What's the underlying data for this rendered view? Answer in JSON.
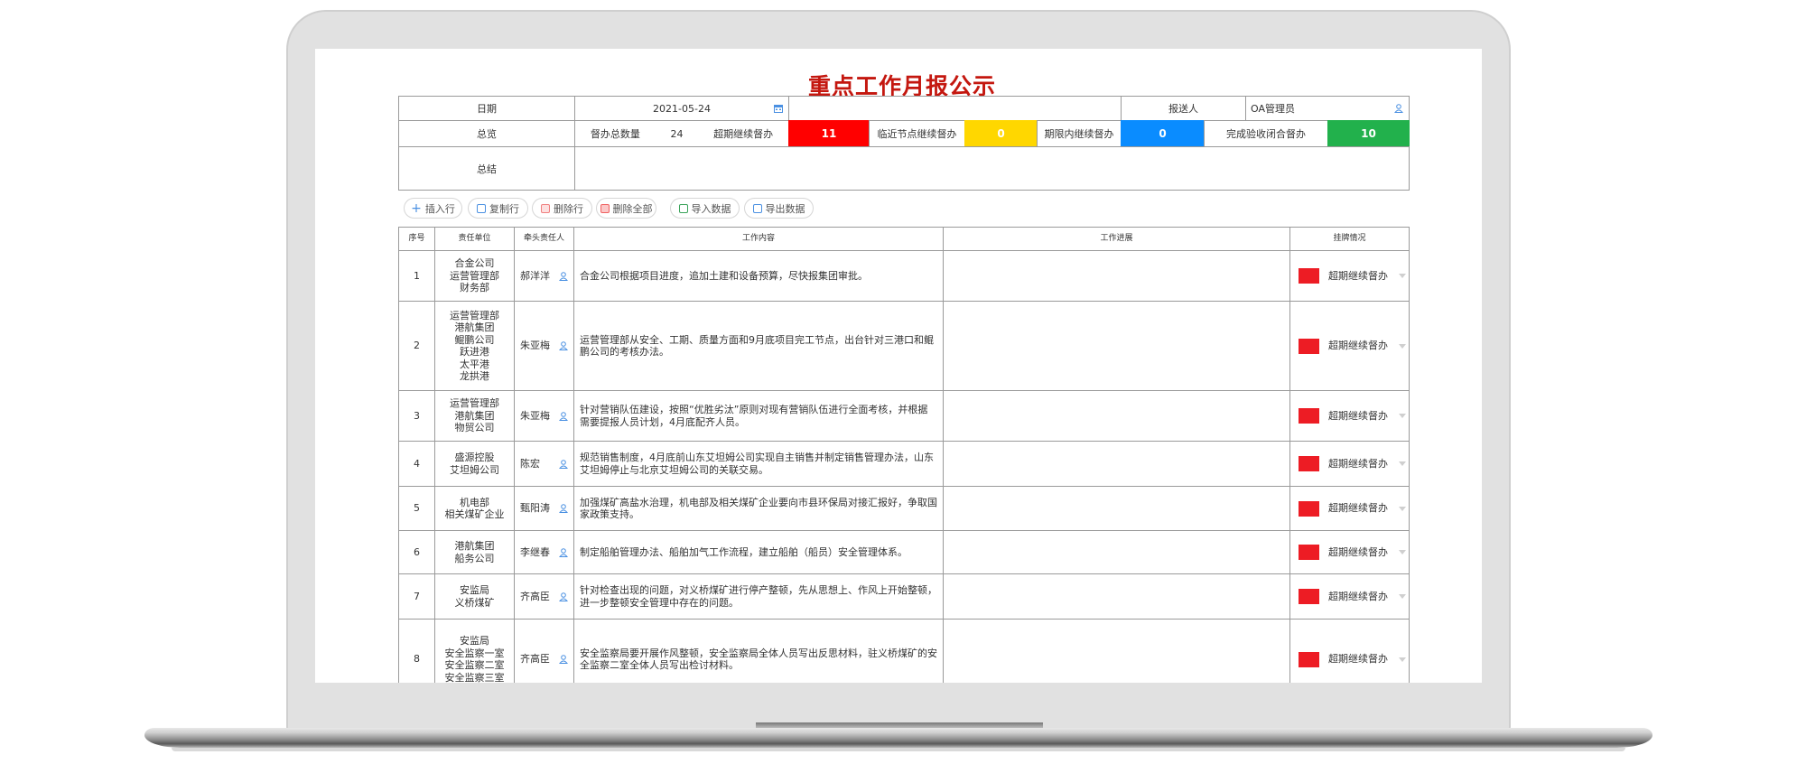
{
  "title": "重点工作月报公示",
  "header": {
    "date_label": "日期",
    "date_value": "2021-05-24",
    "reporter_label": "报送人",
    "reporter_value": "OA管理员",
    "overview_label": "总览",
    "total_label": "督办总数量",
    "total_value": "24",
    "overdue_label": "超期继续督办",
    "overdue_value": "11",
    "near_label": "临近节点继续督办",
    "near_value": "0",
    "within_label": "期限内继续督办",
    "within_value": "0",
    "closed_label": "完成验收闭合督办",
    "closed_value": "10",
    "summary_label": "总结",
    "colors": {
      "overdue": "#ff0000",
      "near": "#ffd700",
      "within": "#0a8cff",
      "closed": "#22b14c"
    }
  },
  "toolbar": {
    "insert_row": "插入行",
    "copy_row": "复制行",
    "delete_row": "删除行",
    "delete_all": "删除全部",
    "import_data": "导入数据",
    "export_data": "导出数据"
  },
  "table": {
    "columns": [
      "序号",
      "责任单位",
      "牵头责任人",
      "工作内容",
      "工作进展",
      "挂牌情况"
    ],
    "status_color": "#ed1c24",
    "rows": [
      {
        "no": "1",
        "unit": "合金公司\n运营管理部\n财务部",
        "owner": "郝洋洋",
        "content": "合金公司根据项目进度，追加土建和设备预算，尽快报集团审批。",
        "progress": "",
        "status": "超期继续督办"
      },
      {
        "no": "2",
        "unit": "运营管理部\n港航集团\n鲲鹏公司\n跃进港\n太平港\n龙拱港",
        "owner": "朱亚梅",
        "content": "运营管理部从安全、工期、质量方面和9月底项目完工节点，出台针对三港口和鲲鹏公司的考核办法。",
        "progress": "",
        "status": "超期继续督办"
      },
      {
        "no": "3",
        "unit": "运营管理部\n港航集团\n物贸公司",
        "owner": "朱亚梅",
        "content": "针对营销队伍建设，按照“优胜劣汰”原则对现有营销队伍进行全面考核，并根据需要提报人员计划，4月底配齐人员。",
        "progress": "",
        "status": "超期继续督办"
      },
      {
        "no": "4",
        "unit": "盛源控股\n艾坦姆公司",
        "owner": "陈宏",
        "content": "规范销售制度，4月底前山东艾坦姆公司实现自主销售并制定销售管理办法，山东艾坦姆停止与北京艾坦姆公司的关联交易。",
        "progress": "",
        "status": "超期继续督办"
      },
      {
        "no": "5",
        "unit": "机电部\n相关煤矿企业",
        "owner": "甄阳涛",
        "content": "加强煤矿高盐水治理，机电部及相关煤矿企业要向市县环保局对接汇报好，争取国家政策支持。",
        "progress": "",
        "status": "超期继续督办"
      },
      {
        "no": "6",
        "unit": "港航集团\n船务公司",
        "owner": "李继春",
        "content": "制定船舶管理办法、船舶加气工作流程，建立船舶（船员）安全管理体系。",
        "progress": "",
        "status": "超期继续督办"
      },
      {
        "no": "7",
        "unit": "安监局\n义桥煤矿",
        "owner": "齐高臣",
        "content": "针对检查出现的问题，对义桥煤矿进行停产整顿，先从思想上、作风上开始整顿，进一步整顿安全管理中存在的问题。",
        "progress": "",
        "status": "超期继续督办"
      },
      {
        "no": "8",
        "unit": "安监局\n安全监察一室\n安全监察二室\n安全监察三室",
        "owner": "齐高臣",
        "content": "安全监察局要开展作风整顿，安全监察局全体人员写出反思材料，驻义桥煤矿的安全监察二室全体人员写出检讨材料。",
        "progress": "",
        "status": "超期继续督办"
      }
    ]
  }
}
